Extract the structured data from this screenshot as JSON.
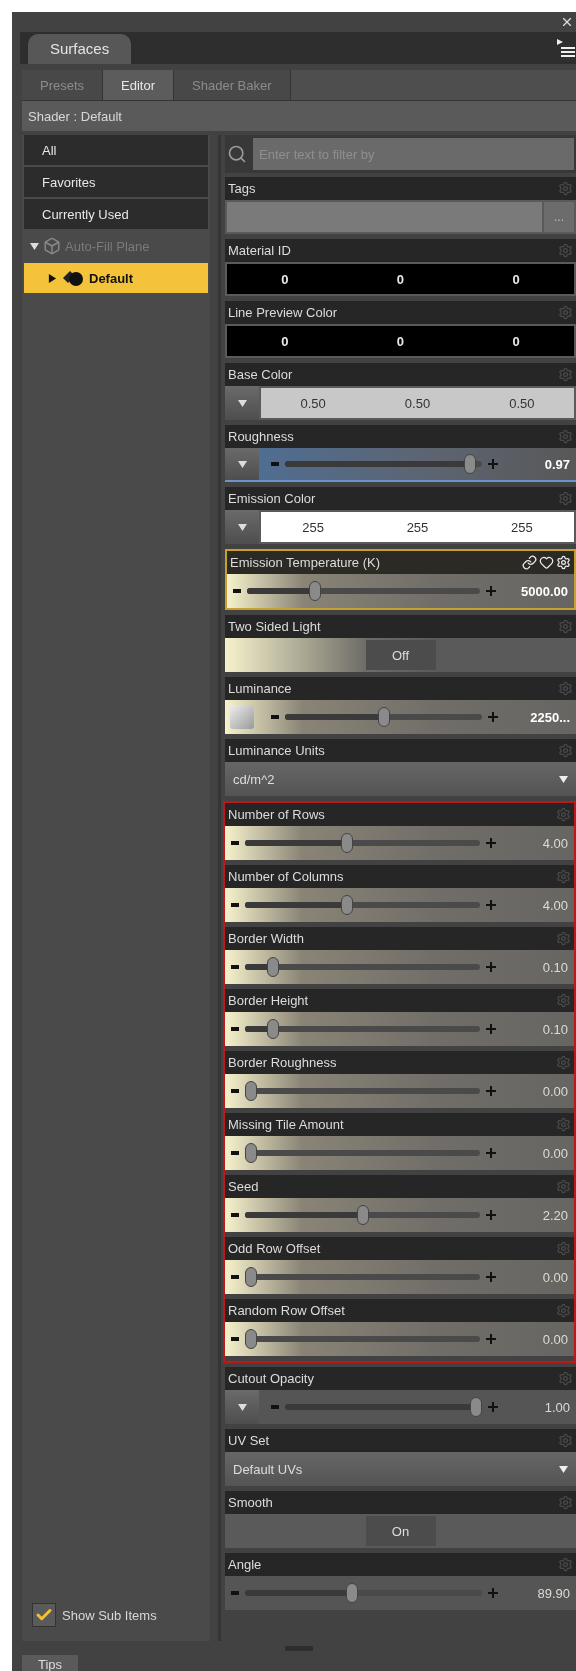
{
  "panel_tab": {
    "label": "Surfaces"
  },
  "tabs": [
    {
      "label": "Presets",
      "selected": false
    },
    {
      "label": "Editor",
      "selected": true
    },
    {
      "label": "Shader Baker",
      "selected": false
    }
  ],
  "shader_label": "Shader : Default",
  "sidebar": {
    "items": [
      {
        "label": "All",
        "selected": false
      },
      {
        "label": "Favorites",
        "selected": false
      },
      {
        "label": "Currently Used",
        "selected": false
      }
    ],
    "tree": [
      {
        "label": "Auto-Fill Plane",
        "expanded": true,
        "selected": false,
        "disabled": true,
        "children": [
          {
            "label": "Default",
            "expanded": false,
            "selected": true,
            "disabled": false
          }
        ]
      }
    ],
    "show_sub_items": {
      "label": "Show Sub Items",
      "checked": true
    }
  },
  "filter": {
    "placeholder": "Enter text to filter by"
  },
  "sections": [
    {
      "highlighted": false,
      "properties": [
        {
          "label": "Tags",
          "kind": "text_button",
          "selected": false,
          "button": "..."
        },
        {
          "label": "Material ID",
          "kind": "color",
          "selected": false,
          "color": "#000000",
          "values": [
            "0",
            "0",
            "0"
          ]
        },
        {
          "label": "Line Preview Color",
          "kind": "color",
          "selected": false,
          "color": "#000000",
          "values": [
            "0",
            "0",
            "0"
          ]
        },
        {
          "label": "Base Color",
          "kind": "menu_color",
          "selected": false,
          "color": "#c8c8c8",
          "values": [
            "0.50",
            "0.50",
            "0.50"
          ]
        },
        {
          "label": "Roughness",
          "kind": "menu_slider",
          "selected": false,
          "tinted": false,
          "focused": true,
          "level": 0.97,
          "reading": "0.97",
          "dimmed": false
        },
        {
          "label": "Emission Color",
          "kind": "menu_color",
          "selected": false,
          "color": "#ffffff",
          "values": [
            "255",
            "255",
            "255"
          ]
        },
        {
          "label": "Emission Temperature (K)",
          "kind": "slider",
          "selected": true,
          "tinted": true,
          "focused": false,
          "level": 0.28,
          "reading": "5000.00",
          "dimmed": false
        },
        {
          "label": "Two Sided Light",
          "kind": "toggle",
          "selected": false,
          "tinted": true,
          "value": "Off"
        },
        {
          "label": "Luminance",
          "kind": "swatch_slider",
          "selected": false,
          "tinted": true,
          "focused": false,
          "level": 0.5,
          "reading": "2250...",
          "dimmed": false
        },
        {
          "label": "Luminance Units",
          "kind": "dropdown",
          "selected": false,
          "value": "cd/m^2"
        }
      ]
    },
    {
      "highlighted": true,
      "properties": [
        {
          "label": "Number of Rows",
          "kind": "slider",
          "selected": false,
          "tinted": true,
          "focused": false,
          "level": 0.43,
          "reading": "4.00",
          "dimmed": true
        },
        {
          "label": "Number of Columns",
          "kind": "slider",
          "selected": false,
          "tinted": true,
          "focused": false,
          "level": 0.43,
          "reading": "4.00",
          "dimmed": true
        },
        {
          "label": "Border Width",
          "kind": "slider",
          "selected": false,
          "tinted": true,
          "focused": false,
          "level": 0.1,
          "reading": "0.10",
          "dimmed": true
        },
        {
          "label": "Border Height",
          "kind": "slider",
          "selected": false,
          "tinted": true,
          "focused": false,
          "level": 0.1,
          "reading": "0.10",
          "dimmed": true
        },
        {
          "label": "Border Roughness",
          "kind": "slider",
          "selected": false,
          "tinted": true,
          "focused": false,
          "level": 0,
          "reading": "0.00",
          "dimmed": true
        },
        {
          "label": "Missing Tile Amount",
          "kind": "slider",
          "selected": false,
          "tinted": true,
          "focused": false,
          "level": 0,
          "reading": "0.00",
          "dimmed": true
        },
        {
          "label": "Seed",
          "kind": "slider",
          "selected": false,
          "tinted": true,
          "focused": false,
          "level": 0.5,
          "reading": "2.20",
          "dimmed": true
        },
        {
          "label": "Odd Row Offset",
          "kind": "slider",
          "selected": false,
          "tinted": true,
          "focused": false,
          "level": 0,
          "reading": "0.00",
          "dimmed": true
        },
        {
          "label": "Random Row Offset",
          "kind": "slider",
          "selected": false,
          "tinted": true,
          "focused": false,
          "level": 0,
          "reading": "0.00",
          "dimmed": true
        }
      ]
    },
    {
      "highlighted": false,
      "properties": [
        {
          "label": "Cutout Opacity",
          "kind": "menu_slider",
          "selected": false,
          "tinted": false,
          "focused": false,
          "level": 1,
          "reading": "1.00",
          "dimmed": true
        },
        {
          "label": "UV Set",
          "kind": "dropdown",
          "selected": false,
          "value": "Default UVs"
        },
        {
          "label": "Smooth",
          "kind": "toggle",
          "selected": false,
          "tinted": false,
          "value": "On"
        },
        {
          "label": "Angle",
          "kind": "slider",
          "selected": false,
          "tinted": false,
          "focused": false,
          "level": 0.45,
          "reading": "89.90",
          "dimmed": true
        }
      ]
    }
  ],
  "bottom_tab": {
    "label": "Tips"
  }
}
